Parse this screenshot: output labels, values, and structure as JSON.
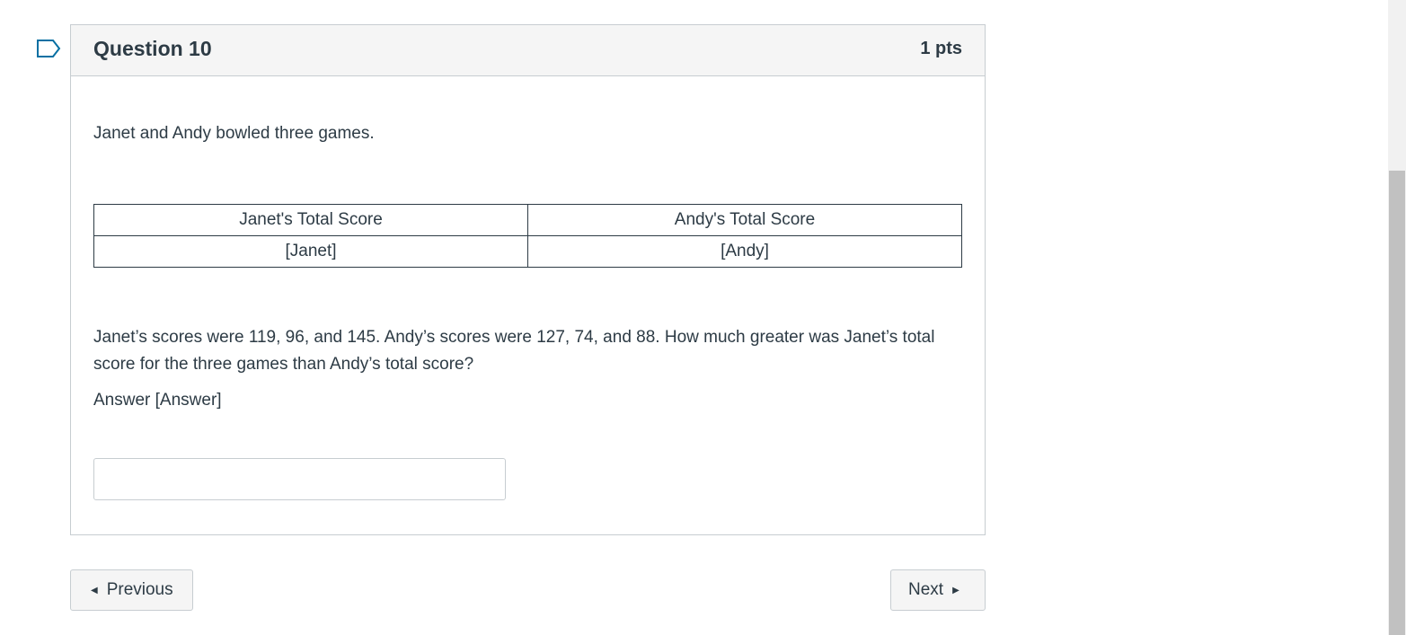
{
  "question": {
    "title": "Question 10",
    "points": "1 pts",
    "intro": "Janet and Andy bowled three games.",
    "table": {
      "headers": [
        "Janet's Total Score",
        "Andy's Total Score"
      ],
      "row": [
        "[Janet]",
        "[Andy]"
      ]
    },
    "problem": "Janet’s scores were 119, 96, and 145. Andy’s scores were 127, 74, and 88. How much greater was Janet’s total score for the three games than Andy’s total score?",
    "answer_label": "Answer [Answer]",
    "answer_value": ""
  },
  "nav": {
    "previous_label": "Previous",
    "next_label": "Next"
  },
  "icons": {
    "flag": "flag-outline-icon",
    "prev": "triangle-left-icon",
    "next": "triangle-right-icon"
  },
  "colors": {
    "text": "#2d3b45",
    "border": "#c7cdd1",
    "header_bg": "#f5f5f5",
    "flag": "#0770a3"
  }
}
